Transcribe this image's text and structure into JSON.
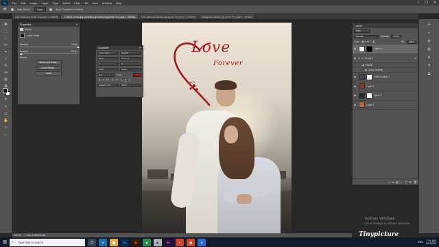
{
  "menubar": {
    "logo": "Ps",
    "items": [
      "File",
      "Edit",
      "Image",
      "Layer",
      "Type",
      "Select",
      "Filter",
      "3D",
      "View",
      "Window",
      "Help"
    ],
    "controls": [
      "–",
      "❐",
      "✕"
    ]
  },
  "options": {
    "auto_select_label": "Auto-Select:",
    "auto_select_value": "Layer",
    "show_transform_label": "Show Transform Controls"
  },
  "tabs": [
    {
      "label": "love-frame.png @ 66.7% (Layer 1, RGB/8)",
      "active": false
    },
    {
      "label": "3.38155_heart-png-romantic-clip-frame.png @ 66.7% (Layer 1, RGB/8)",
      "active": true
    },
    {
      "label": "love-with-love-flowers.psd @ 66.7% (Layer 1, RGB/8)",
      "active": false
    },
    {
      "label": "background-texture.jpg @ 66.7% (Layer 1, RGB/8)",
      "active": false
    }
  ],
  "toolbar": {
    "tools": [
      "✥",
      "⬚",
      "◌",
      "✄",
      "⌖",
      "⟋",
      "✎",
      "⛀",
      "◍",
      "⧉",
      "✐",
      "T",
      "↖",
      "▭",
      "✋",
      "⌕",
      "…"
    ]
  },
  "properties": {
    "title": "Properties",
    "subtitle": "Masks",
    "layer_mask_label": "Layer Mask",
    "density_label": "Density:",
    "density_value": "100%",
    "feather_label": "Feather:",
    "feather_value": "0.0 px",
    "refine_label": "Refine:",
    "select_mask_btn": "Select and Mask...",
    "color_range_btn": "Color Range...",
    "invert_btn": "Invert"
  },
  "character": {
    "title": "Character",
    "font": "Great Vibes",
    "style": "Regular",
    "size": "36 pt",
    "leading": "57.71 pt",
    "kerning": "0",
    "tracking": "0",
    "scale_v": "100%",
    "scale_h": "100%",
    "baseline": "0 pt",
    "color_label": "Color:",
    "styles": [
      "T",
      "T",
      "TT",
      "Tr",
      "T¹",
      "T₁",
      "T",
      "T̶"
    ],
    "language": "English: USA",
    "antialias": "Sharp"
  },
  "canvas": {
    "love_title": "Love",
    "love_subtitle": "Forever"
  },
  "layers": {
    "tabs": "Layers",
    "kind_label": "Kind",
    "blend_mode": "Normal",
    "opacity_label": "Opacity:",
    "opacity_value": "100%",
    "lock_label": "Lock:",
    "fill_label": "Fill:",
    "fill_value": "100%",
    "rows": [
      {
        "name": "Layer 4",
        "selected": true,
        "thumb": "#ffffff"
      },
      {
        "name": "Group 1",
        "selected": false,
        "thumb": "#7a7a7a"
      },
      {
        "name": "Effects",
        "selected": false,
        "sub": true
      },
      {
        "name": "Color Overlay",
        "selected": false,
        "sub": true
      },
      {
        "name": "Color Lookup 1",
        "selected": false,
        "thumb": "#ffffff"
      },
      {
        "name": "Layer 3",
        "selected": false,
        "thumb": "#8a3a22"
      },
      {
        "name": "Layer 2",
        "selected": false,
        "thumb": "#2b2b2b"
      },
      {
        "name": "Layer 1",
        "selected": false,
        "thumb": "#b36a3d"
      }
    ],
    "footer_icons": [
      "∞",
      "fx",
      "◧",
      "◐",
      "▢",
      "⊞",
      "🗑"
    ]
  },
  "rightstrip": {
    "icons": [
      "☰",
      "◐",
      "⊞",
      "▤",
      "A",
      "¶",
      "⧉"
    ]
  },
  "status": {
    "zoom": "66.7%",
    "doc": "Doc: 6.59M/34.5M"
  },
  "activation": {
    "title": "Activate Windows",
    "subtitle": "Go to Settings to activate Windows."
  },
  "watermark": "Tinypicture",
  "taskbar": {
    "start": "⊞",
    "search_placeholder": "Type here to search",
    "search_icon": "⌕",
    "apps": [
      {
        "label": "❐",
        "color": "#3a4656"
      },
      {
        "label": "e",
        "color": "#1f6fb5"
      },
      {
        "label": "▇",
        "color": "#e0a93a"
      },
      {
        "label": "Ps",
        "color": "#0b2a4a"
      },
      {
        "label": "Ai",
        "color": "#3a1a00"
      },
      {
        "label": "◆",
        "color": "#2c8c4a"
      },
      {
        "label": "▶",
        "color": "#b0b0b0"
      },
      {
        "label": "Pr",
        "color": "#2a0d3e"
      },
      {
        "label": "●",
        "color": "#d8402d"
      },
      {
        "label": "▣",
        "color": "#d24726"
      },
      {
        "label": "♥",
        "color": "#2f6cd3"
      }
    ],
    "time": "7:11 AM",
    "date": "5/4/2020",
    "tray_lang": "ENG"
  },
  "colors": {
    "accent_red": "#b11a22",
    "panel_bg": "#535353",
    "workspace_bg": "#282828",
    "taskbar_bg": "#101c2c"
  }
}
